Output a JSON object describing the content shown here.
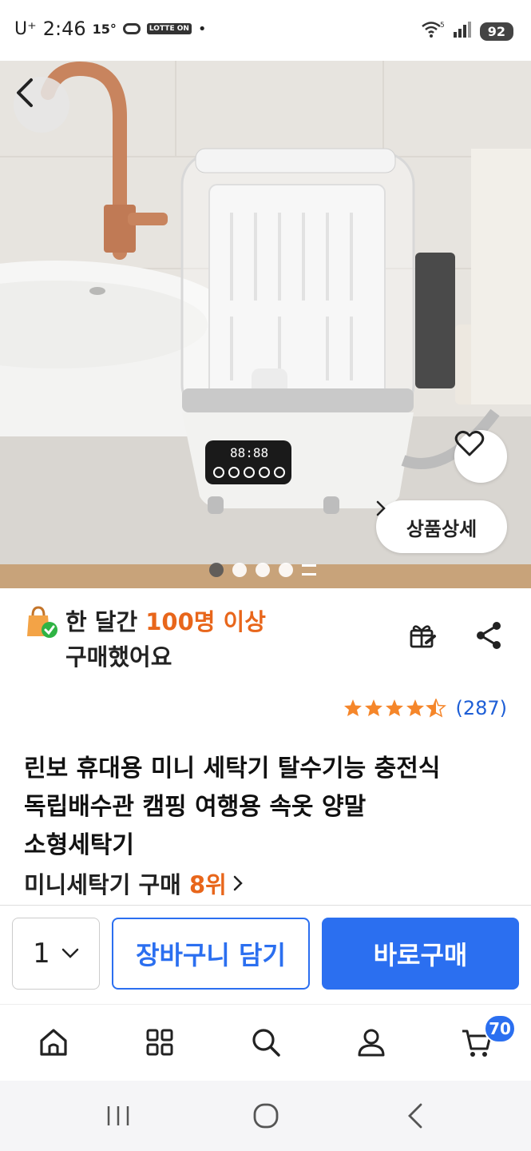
{
  "status_bar": {
    "carrier": "U⁺",
    "time": "2:46",
    "temperature": "15°",
    "badge_lotte": "LOTTE ON",
    "dot": "•",
    "wifi_band": "5",
    "battery": "92"
  },
  "hero": {
    "detail_button_label": "상품상세",
    "pager_dots": 4,
    "active_dot": 0
  },
  "purchase": {
    "prefix": "한 달간 ",
    "highlight": "100명 이상",
    "suffix": "구매했어요"
  },
  "rating": {
    "stars": 4.5,
    "count": "(287)"
  },
  "product": {
    "title_line1": "린보 휴대용 미니 세탁기 탈수기능 충전식",
    "title_line2": "독립배수관 캠핑 여행용 속옷 양말",
    "title_line3": "소형세탁기",
    "rank_prefix": "미니세탁기 구매 ",
    "rank_value": "8위"
  },
  "buy_bar": {
    "quantity": "1",
    "cart_label": "장바구니 담기",
    "buy_label": "바로구매"
  },
  "bottom_nav": {
    "cart_badge": "70"
  },
  "colors": {
    "accent_blue": "#2b6ff0",
    "highlight_orange": "#e8661b",
    "star_orange": "#f5862a"
  }
}
